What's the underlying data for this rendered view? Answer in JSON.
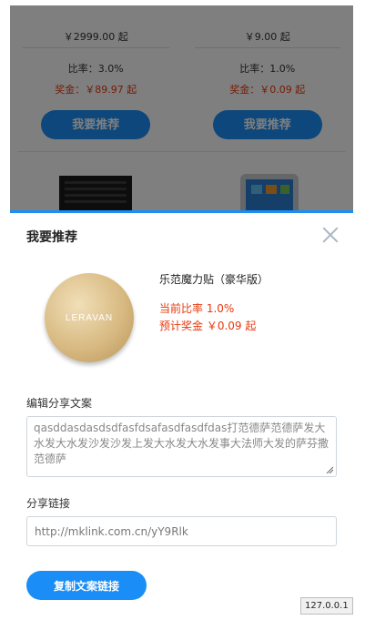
{
  "products": [
    {
      "price": "￥2999.00 起",
      "rate": "比率：3.0%",
      "bonus": "奖金：￥89.97 起",
      "button": "我要推荐"
    },
    {
      "price": "￥9.00 起",
      "rate": "比率：1.0%",
      "bonus": "奖金：￥0.09 起",
      "button": "我要推荐"
    }
  ],
  "modal": {
    "title": "我要推荐",
    "product": {
      "logo_text": "LERAVAN",
      "name": "乐范魔力贴（豪华版）",
      "rate": "当前比率 1.0%",
      "bonus": "预计奖金 ￥0.09 起"
    },
    "copy_label": "编辑分享文案",
    "copy_text": "qasddasdasdsdfasfdsafasdfasdfdas打范德萨范德萨发大水发大水发沙发沙发上发大水发大水发事大法师大发的萨芬撒范德萨",
    "link_label": "分享链接",
    "link_value": "http://mklink.com.cn/yY9Rlk",
    "copy_button": "复制文案链接"
  },
  "statusbar": "127.0.0.1",
  "colors": {
    "accent": "#1a8ef6",
    "bonus_red": "#e8380d"
  },
  "icons": {
    "close": "close-icon",
    "resize": "resize-grip-icon"
  }
}
